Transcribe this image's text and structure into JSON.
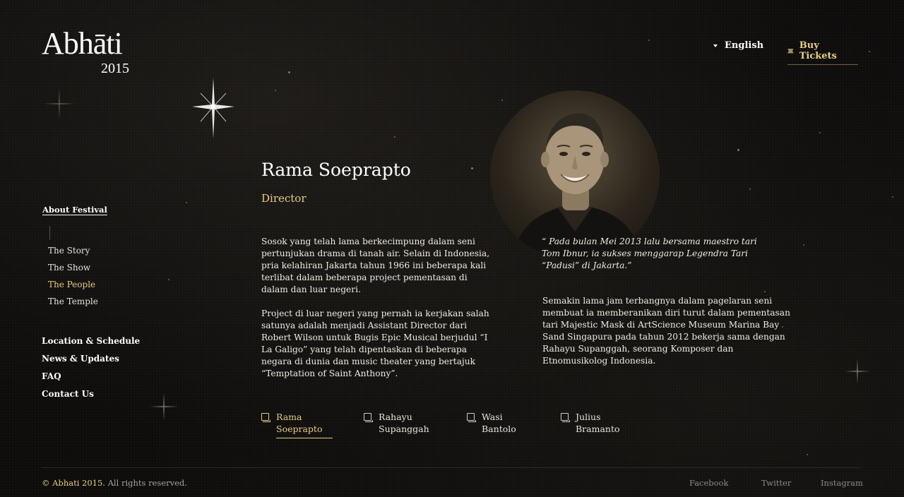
{
  "header": {
    "logo_word": "Abhāti",
    "logo_year": "2015",
    "language": "English",
    "buy_tickets": "Buy Tickets"
  },
  "nav": {
    "about": "About Festival",
    "sub_items": [
      "The Story",
      "The Show",
      "The People",
      "The Temple"
    ],
    "active_sub": "The People",
    "main_items": [
      "Location & Schedule",
      "News & Updates",
      "FAQ",
      "Contact Us"
    ]
  },
  "person": {
    "name": "Rama Soeprapto",
    "role": "Director",
    "bio_1": "Sosok yang telah lama berkecimpung dalam seni pertunjukan drama di tanah air. Selain di Indonesia, pria kelahiran Jakarta tahun 1966 ini beberapa kali terlibat dalam beberapa project pementasan di dalam dan luar negeri.",
    "bio_2": "Project di luar negeri yang pernah ia kerjakan salah satunya adalah menjadi Assistant Director dari Robert Wilson untuk Bugis Epic Musical berjudul “I La Galigo” yang telah dipentaskan di beberapa negara di dunia dan music theater yang bertajuk “Temptation of Saint Anthony”.",
    "quote": "“ Pada bulan Mei 2013 lalu bersama maestro tari Tom Ibnur, ia sukses menggarap Legendra Tari “Padusi” di Jakarta.”",
    "bio_3": "Semakin lama jam terbangnya dalam pagelaran seni membuat ia memberanikan diri turut dalam pementasan tari Majestic Mask di ArtScience Museum Marina Bay Sand Singapura pada tahun 2012 bekerja sama dengan Rahayu Supanggah, seorang Komposer dan Etnomusikolog Indonesia."
  },
  "people": [
    {
      "first": "Rama",
      "last": "Soeprapto",
      "active": true
    },
    {
      "first": "Rahayu",
      "last": "Supanggah",
      "active": false
    },
    {
      "first": "Wasi",
      "last": "Bantolo",
      "active": false
    },
    {
      "first": "Julius",
      "last": "Bramanto",
      "active": false
    }
  ],
  "footer": {
    "brand": "© Abhati 2015.",
    "rights": " All rights reserved.",
    "social": [
      "Facebook",
      "Twitter",
      "Instagram"
    ]
  },
  "colors": {
    "accent_gold": "#e7cd80",
    "background": "#0d0c0b",
    "text": "#e8e4dc"
  },
  "icons": [
    "caret-down-icon",
    "ticket-icon",
    "book-icon",
    "sparkle-star-icon"
  ]
}
